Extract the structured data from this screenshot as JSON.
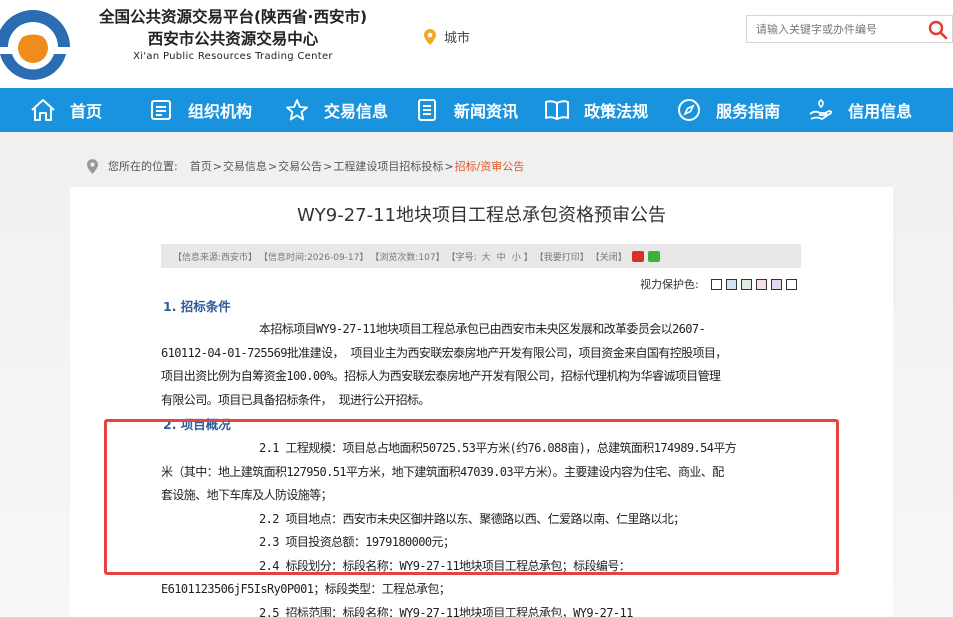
{
  "header": {
    "title_line1": "全国公共资源交易平台(陕西省·西安市)",
    "title_line2": "西安市公共资源交易中心",
    "title_en": "Xi'an Public Resources Trading Center",
    "city_label": "城市",
    "search_placeholder": "请输入关键字或办件编号"
  },
  "nav": {
    "items": [
      {
        "label": "首页",
        "icon": "home-icon"
      },
      {
        "label": "组织机构",
        "icon": "organization-icon"
      },
      {
        "label": "交易信息",
        "icon": "star-icon"
      },
      {
        "label": "新闻资讯",
        "icon": "news-icon"
      },
      {
        "label": "政策法规",
        "icon": "book-icon"
      },
      {
        "label": "服务指南",
        "icon": "compass-icon"
      },
      {
        "label": "信用信息",
        "icon": "credit-icon"
      }
    ]
  },
  "breadcrumb": {
    "prefix": "您所在的位置:",
    "items": [
      "首页",
      "交易信息",
      "交易公告",
      "工程建设项目招标投标"
    ],
    "current": "招标/资审公告",
    "separator": ">"
  },
  "article": {
    "title": "WY9-27-11地块项目工程总承包资格预审公告",
    "meta": {
      "source": "【信息来源:西安市】",
      "time": "【信息时间:2026-09-17】",
      "views": "【浏览次数:107】",
      "font_label": "【字号:",
      "size_large": "大",
      "size_medium": "中",
      "size_small": "小",
      "font_close": "】",
      "print": "【我要打印】",
      "close": "【关闭】"
    },
    "eye_protect_label": "视力保护色:",
    "eye_colors": [
      "#ffffff",
      "#fae9d8",
      "#cfe5f3",
      "#e0ece0",
      "#f5e0e8",
      "#e3d8f0",
      "#ffffff"
    ],
    "section1_heading": "1. 招标条件",
    "section1_lines": [
      "本招标项目WY9-27-11地块项目工程总承包已由西安市未央区发展和改革委员会以2607-",
      "610112-04-01-725569批准建设， 项目业主为西安联宏泰房地产开发有限公司，项目资金来自国有控股项目，",
      "项目出资比例为自筹资金100.00%。招标人为西安联宏泰房地产开发有限公司，招标代理机构为华睿诚项目管理",
      "有限公司。项目已具备招标条件， 现进行公开招标。"
    ],
    "section2_heading": "2. 项目概况",
    "section2_lines": [
      "2.1 工程规模：项目总占地面积50725.53平方米(约76.088亩)，总建筑面积174989.54平方",
      "米（其中：地上建筑面积127950.51平方米，地下建筑面积47039.03平方米）。主要建设内容为住宅、商业、配",
      "套设施、地下车库及人防设施等；",
      "2.2 项目地点：西安市未央区御井路以东、聚德路以西、仁爱路以南、仁里路以北；",
      "2.3 项目投资总额：1979180000元；",
      "2.4 标段划分：标段名称：WY9-27-11地块项目工程总承包；标段编号：",
      "E6101123506jF5IsRy0P001；标段类型：工程总承包；",
      "2.5 招标范围：标段名称：WY9-27-11地块项目工程总承包，WY9-27-11"
    ]
  }
}
